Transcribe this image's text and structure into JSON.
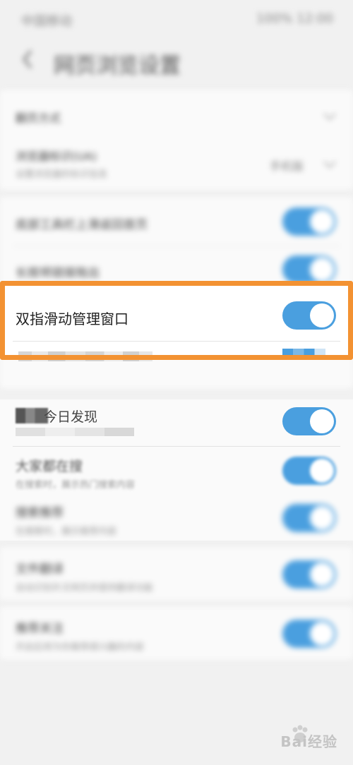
{
  "status_bar": {
    "left": "中国移动",
    "right": "100% 12:00"
  },
  "header": {
    "title": "网页浏览设置"
  },
  "section1": {
    "row1": {
      "title": "翻页方式"
    },
    "row2": {
      "title": "浏览器标识(UA)",
      "subtitle": "设置浏览器的标识信息",
      "value": "手机版"
    }
  },
  "section2": {
    "row1": {
      "title": "底部工具栏上滑返回首页"
    },
    "row2": {
      "title": "长按将链接拖出"
    },
    "highlight": {
      "title": "双指滑动管理窗口"
    }
  },
  "section3": {
    "row1": {
      "title": "今日发现"
    },
    "row2": {
      "title": "大家都在搜",
      "subtitle": "在搜索时，展示热门搜索内容"
    },
    "row3": {
      "title": "搜索推荐",
      "subtitle": "在搜索时，展示推荐内容"
    }
  },
  "section4": {
    "row1": {
      "title": "文件翻译",
      "subtitle": "自动识别外文网页并提供翻译功能"
    }
  },
  "section5": {
    "row1": {
      "title": "推荐关注",
      "subtitle": "开启后将为你推荐感兴趣的内容"
    }
  },
  "watermark": {
    "text": "Bai经验"
  },
  "colors": {
    "accent": "#4a9fdf",
    "highlight": "#f39232"
  },
  "icons": {
    "back": "chevron-left-icon",
    "chevron": "chevron-down-icon"
  }
}
